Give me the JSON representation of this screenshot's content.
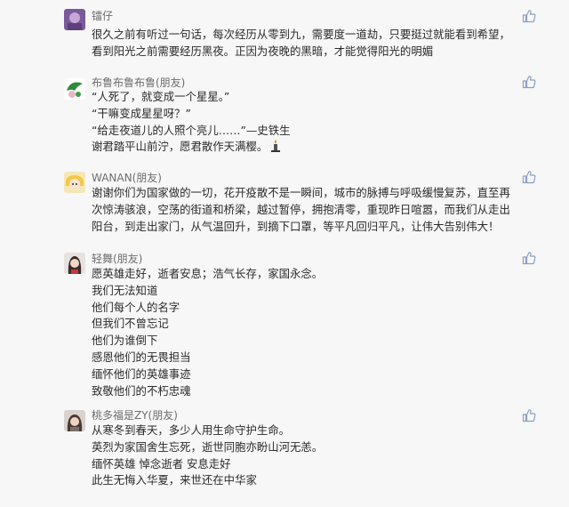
{
  "comments": [
    {
      "username": "镭仔",
      "lines": [
        "很久之前有听过一句话，每次经历从零到九，需要度一道劫，只要挺过就能看到希望，",
        "看到阳光之前需要经历黑夜。正因为夜晚的黑暗，才能觉得阳光的明媚"
      ],
      "avatar": "avatar-purple"
    },
    {
      "username": "布鲁布鲁布鲁(朋友)",
      "lines": [
        "“人死了，就变成一个星星。”",
        "“干嘛变成星星呀？”",
        "“给走夜道儿的人照个亮儿……”—史铁生",
        "谢君踏平山前泞，愿君散作天满樱。"
      ],
      "avatar": "avatar-green"
    },
    {
      "username": "WANAN(朋友)",
      "lines": [
        "谢谢你们为国家做的一切，花开疫散不是一瞬间，城市的脉搏与呼吸缓慢复苏，直至再",
        "次惊涛骇浪，空荡的街道和桥梁，越过暂停，拥抱清零，重现昨日喧嚣，而我们从走出",
        "阳台，到走出家门，从气温回升，到摘下口罩，等平凡回归平凡，让伟大告别伟大！"
      ],
      "avatar": "avatar-anime"
    },
    {
      "username": "轻舞(朋友)",
      "lines": [
        "愿英雄走好，逝者安息；浩气长存，家国永念。",
        "我们无法知道",
        "他们每个人的名字",
        "但我们不曾忘记",
        "他们为谁倒下",
        "感恩他们的无畏担当",
        "缅怀他们的英雄事迹",
        "致敬他们的不朽忠魂"
      ],
      "avatar": "avatar-girl"
    },
    {
      "username": "桃多福是ZY(朋友)",
      "lines": [
        "从寒冬到春天，多少人用生命守护生命。",
        "英烈为家国舍生忘死，逝世同胞亦盼山河无恙。",
        "缅怀英雄 悼念逝者 安息走好",
        "此生无悔入华夏，来世还在中华家"
      ],
      "avatar": "avatar-woman"
    }
  ],
  "icons": {
    "like": "thumbs-up-icon",
    "candle": "candle-icon"
  },
  "colors": {
    "background": "#f7f7f7",
    "username": "#6d6d6d",
    "text": "#2a2a2a",
    "icon": "#8aa0c0"
  }
}
